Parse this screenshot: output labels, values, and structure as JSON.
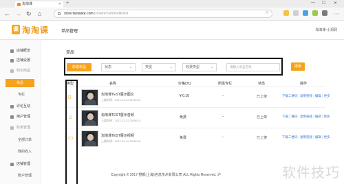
{
  "browser": {
    "tab_title": "淘淘课",
    "url_host": "store.taotaoke.com",
    "url_path": "/content/commodity/list"
  },
  "header": {
    "logo_badge": "课",
    "logo_text": "淘淘课",
    "title": "单品管理",
    "user": "淘淘课-小洞洞"
  },
  "sidebar": {
    "items": [
      {
        "label": "店铺概览"
      },
      {
        "label": "店铺设置"
      },
      {
        "label": "知识商品"
      },
      {
        "label": "单品"
      },
      {
        "label": "专栏"
      },
      {
        "label": "评论互动"
      },
      {
        "label": "用户管理"
      },
      {
        "label": "财务管理"
      },
      {
        "label": "全部订单"
      },
      {
        "label": "我的收入"
      },
      {
        "label": "店铺管理"
      },
      {
        "label": "账户管理"
      }
    ]
  },
  "main": {
    "breadcrumb": "单品",
    "filters": {
      "create_button": "新建单品",
      "status_select": "状态",
      "type_select": "类型",
      "charge_select": "收费类型",
      "search_placeholder": "请输入单品名称",
      "search_button": "搜索"
    },
    "columns": [
      "类型",
      "名称",
      "价格(元)",
      "所属专栏",
      "状态",
      "操作"
    ],
    "rows": [
      {
        "type_icon": "▯",
        "title": "淘淘课TEST展示图文",
        "meta": "上架时间：2017-12-12 21:26:04",
        "price": "¥ 0.10",
        "column": "--",
        "status": "已上架",
        "ops": [
          "下载二维码",
          "复制链接",
          "编辑",
          "更多"
        ]
      },
      {
        "type_icon": "♫",
        "title": "淘淘课TEST展示音频",
        "meta": "上架时间：2017-12-12 20:58:13",
        "price": "免费",
        "column": "--",
        "status": "已上架",
        "ops": [
          "下载二维码",
          "复制链接",
          "编辑",
          "更多"
        ]
      },
      {
        "type_icon": "▭",
        "title": "淘淘课TEST展示视频",
        "meta": "上架时间：2017-12-12 20:58:18",
        "price": "免费",
        "column": "--",
        "status": "已上架",
        "ops": [
          "下载二维码",
          "复制链接",
          "编辑",
          "更多"
        ]
      }
    ],
    "footer": "Copyright © 2017 橙眼(上海)信息技术有限公司 ALL Rights Reserved. 沪"
  },
  "watermark": "软件技巧"
}
